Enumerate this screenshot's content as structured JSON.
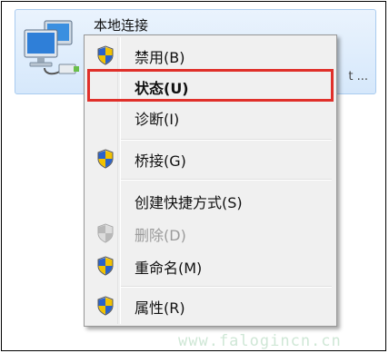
{
  "adapter": {
    "name": "本地连接",
    "description_trailing": "t ..."
  },
  "menu": {
    "items": [
      {
        "label": "禁用(B)",
        "icon": "uac-shield-icon",
        "bold": false,
        "disabled": false
      },
      {
        "label": "状态(U)",
        "icon": null,
        "bold": true,
        "disabled": false
      },
      {
        "label": "诊断(I)",
        "icon": null,
        "bold": false,
        "disabled": false
      },
      {
        "label": "桥接(G)",
        "icon": "uac-shield-icon",
        "bold": false,
        "disabled": false
      },
      {
        "label": "创建快捷方式(S)",
        "icon": null,
        "bold": false,
        "disabled": false
      },
      {
        "label": "删除(D)",
        "icon": "uac-shield-icon",
        "bold": false,
        "disabled": true
      },
      {
        "label": "重命名(M)",
        "icon": "uac-shield-icon",
        "bold": false,
        "disabled": false
      },
      {
        "label": "属性(R)",
        "icon": "uac-shield-icon",
        "bold": false,
        "disabled": false
      }
    ]
  },
  "annotation": {
    "highlight_color": "#e0302a",
    "highlighted_item": "状态(U)"
  },
  "watermark": "www.falogincn.cn"
}
